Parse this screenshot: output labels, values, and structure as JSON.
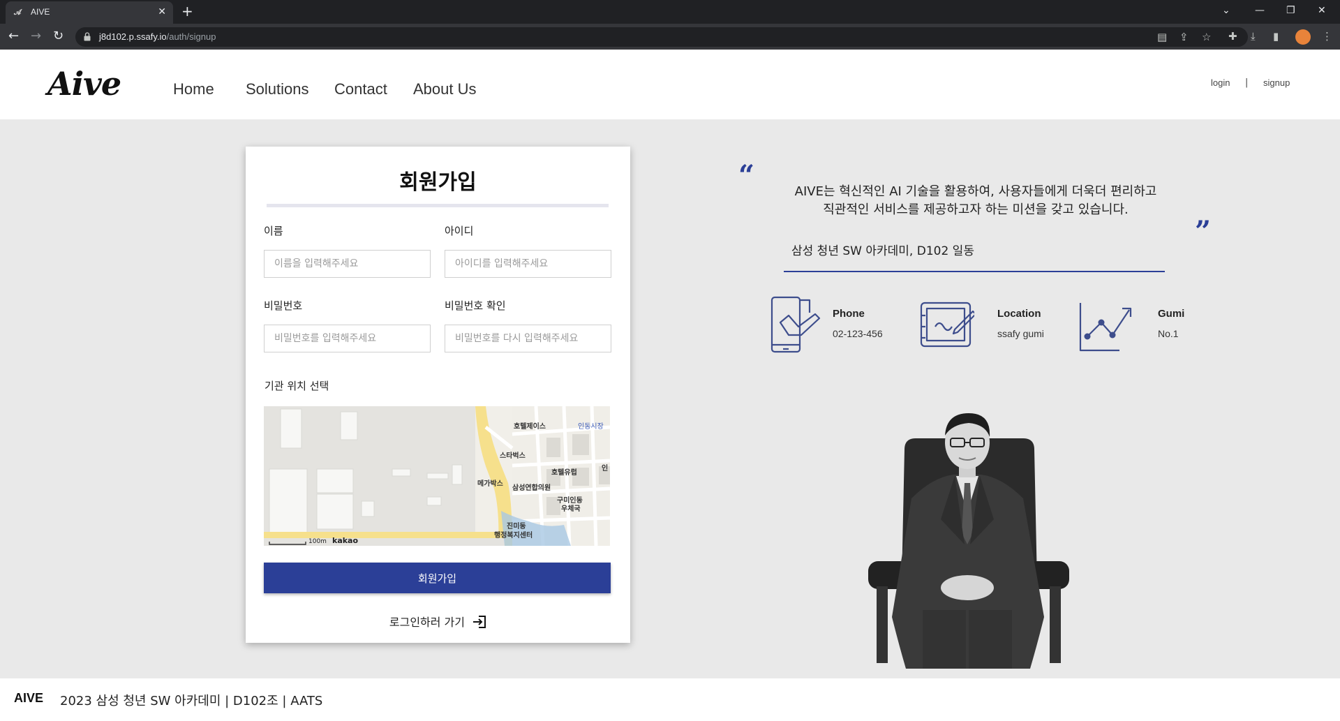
{
  "browser": {
    "tab_title": "AIVE",
    "tab_favicon": "AIVE",
    "url_host": "j8d102.p.ssafy.io",
    "url_path": "/auth/signup"
  },
  "header": {
    "logo": "Aive",
    "nav": [
      "Home",
      "Solutions",
      "Contact",
      "About Us"
    ],
    "login": "login",
    "separator": "|",
    "signup": "signup"
  },
  "form": {
    "title": "회원가입",
    "name_label": "이름",
    "name_placeholder": "이름을 입력해주세요",
    "id_label": "아이디",
    "id_placeholder": "아이디를 입력해주세요",
    "password_label": "비밀번호",
    "password_placeholder": "비밀번호를 입력해주세요",
    "password_confirm_label": "비밀번호 확인",
    "password_confirm_placeholder": "비밀번호를 다시 입력해주세요",
    "location_label": "기관 위치 선택",
    "submit": "회원가입",
    "goto_login": "로그인하러 가기"
  },
  "map": {
    "labels": [
      "호텔제이스",
      "인동시장",
      "스타벅스",
      "호텔유럽",
      "메가박스",
      "삼성연합의원",
      "구미인동",
      "우체국",
      "진미동",
      "행정복지센터",
      "인"
    ],
    "scale": "100m",
    "brand": "kakao"
  },
  "about": {
    "mission_line1": "AIVE는 혁신적인 AI 기술을 활용하여, 사용자들에게 더욱더 편리하고",
    "mission_line2": "직관적인 서비스를 제공하고자 하는 미션을 갖고 있습니다.",
    "org": "삼성 청년 SW 아카데미, D102 일동",
    "quote_open": "“",
    "quote_close": "”",
    "info": [
      {
        "title": "Phone",
        "value": "02-123-456",
        "icon": "phone-icon"
      },
      {
        "title": "Location",
        "value": "ssafy gumi",
        "icon": "location-icon"
      },
      {
        "title": "Gumi",
        "value": "No.1",
        "icon": "chart-icon"
      }
    ]
  },
  "footer": {
    "brand": "AIVE",
    "text": "2023 삼성 청년 SW 아카데미 | D102조 | AATS"
  },
  "colors": {
    "accent": "#2b3f97",
    "page_bg": "#e9e9e9"
  }
}
